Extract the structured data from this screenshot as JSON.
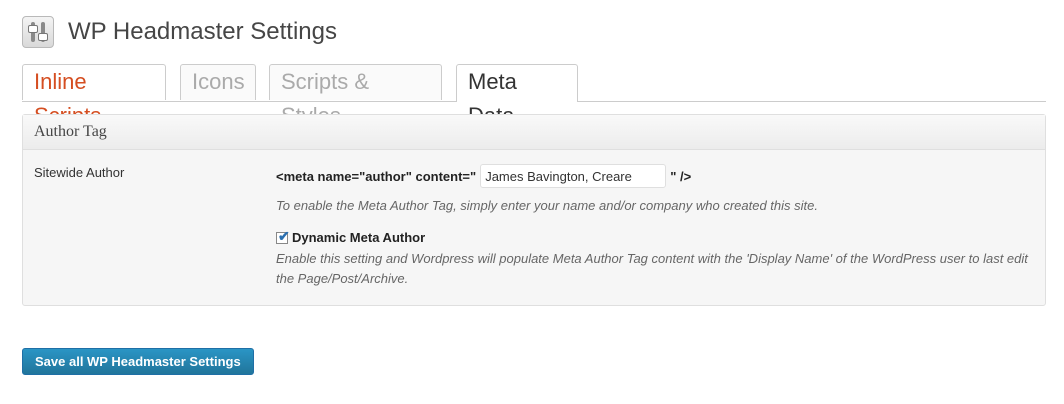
{
  "header": {
    "title": "WP Headmaster Settings",
    "icon": "sliders-icon"
  },
  "tabs": [
    {
      "label": "Inline Scripts"
    },
    {
      "label": "Icons"
    },
    {
      "label": "Scripts & Styles"
    },
    {
      "label": "Meta Data"
    }
  ],
  "panel": {
    "heading": "Author Tag",
    "row_label": "Sitewide Author",
    "meta_prefix": "<meta name=\"author\" content=\"",
    "author_value": "James Bavington, Creare",
    "meta_suffix": "\" />",
    "author_description": "To enable the Meta Author Tag, simply enter your name and/or company who created this site.",
    "dynamic_label": "Dynamic Meta Author",
    "dynamic_checked": true,
    "dynamic_description": "Enable this setting and Wordpress will populate Meta Author Tag content with the 'Display Name' of the WordPress user to last edit the Page/Post/Archive."
  },
  "footer": {
    "save_label": "Save all WP Headmaster Settings"
  },
  "colors": {
    "accent_red": "#d54e21",
    "button_blue": "#21759b"
  }
}
